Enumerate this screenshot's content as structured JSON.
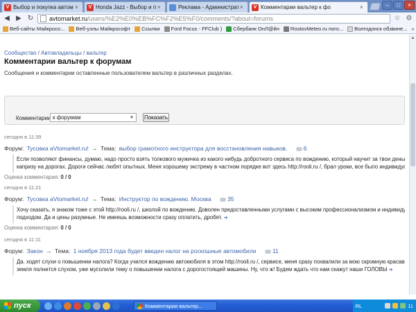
{
  "browser": {
    "tabs": [
      {
        "title": "Выбор и покупка автомобил",
        "favicon": "V",
        "favicon_color": "#d9342b",
        "active": false
      },
      {
        "title": "Honda Jazz - Выбор и покуп",
        "favicon": "V",
        "favicon_color": "#d9342b",
        "active": false
      },
      {
        "title": "Реклама - Административ",
        "favicon": "",
        "favicon_color": "#5b8ed8",
        "active": false
      },
      {
        "title": "Комментарии вальтер к фо",
        "favicon": "V",
        "favicon_color": "#d9342b",
        "active": true
      }
    ],
    "url_host": "avtomarket.ru",
    "url_path": "/users/%E2%E0%EB%FC%F2%E5%F0/comments/?about=forums",
    "bookmarks": [
      {
        "label": "Веб-сайты Майкросо...",
        "color": "#e8a33a"
      },
      {
        "label": "Веб-узлы Майкрософт",
        "color": "#e8a33a"
      },
      {
        "label": "Ссылки",
        "color": "#e8a33a"
      },
      {
        "label": "Ford Focus - FFClub )",
        "color": "#8c8c8c"
      },
      {
        "label": "Сбербанк ОнЛ@йн",
        "color": "#2e9b3f"
      },
      {
        "label": "RostovMeteo.ru пого...",
        "color": "#7a7a7a"
      },
      {
        "label": "Волгодонск обзвине...",
        "color": "#d6d6d6"
      }
    ],
    "bookmarks_more": "»"
  },
  "page": {
    "breadcrumbs": [
      "Сообщество",
      "Автовладельцы",
      "вальтер"
    ],
    "crumb_sep": " / ",
    "title": "Комментарии вальтер к форумам",
    "description": "Сообщения и комментарии оставленные пользователем вальтер в различных разделах.",
    "filter": {
      "label": "Комментарии:",
      "selected": "к форумам",
      "button": "Показать"
    },
    "forum_label": "Форум:",
    "topic_label": "Тема:",
    "arrow": "→",
    "rating_label": "Оценка комментария:",
    "comments": [
      {
        "time": "сегодня в 11:39",
        "forum": "Тусовка aVtomarket.ru!",
        "topic": "выбор грамотного инструктора для восстановления навыков.",
        "count": "6",
        "lines": [
          "Если позволяют финансы, думаю, надо просто взять толкового мужичка из какого нибудь добротного сервиса  по вождению, который научит за твои деньки любому",
          "капризу на дорогах.  Дороги сейчас любят опытных.  Меня хорошему экстрему в частном порядке вот здесь  http://rooli.ru /,  брал уроки,  все было индивидуально."
        ],
        "rating": "0 / 0"
      },
      {
        "time": "сегодня в 11:21",
        "forum": "Тусовка aVtomarket.ru!",
        "topic": "Инструктор по вождению. Москва",
        "count": "35",
        "lines": [
          "Хочу сказать, я знаком тоже с этой  http://rooli.ru /,  школой по вождению. Доволен предоставленными услугами  с высоким профессионализмом и индивидуальным",
          "подходом. Да и цены разумные. Не имеешь возможности сразу оплатить, дробят."
        ],
        "rating": "0 / 0"
      },
      {
        "time": "сегодня в 11:11",
        "forum": "Закон",
        "topic": "1 ноября 2013 года будет введен налог на роскошные автомобили",
        "count": "11",
        "lines": [
          "Да.  ходят слухи о повышении налога? Когда учился вождению автомобиля в этом http://rooli.ru /, сервисе, меня сразу похвалили за мою скромную красавицу, так как",
          "земля полнится слухом, уже мусолили тему о повышении налога с дорогостоящей машины. Ну, что ж! Будем ждать что нам скажут наши ГОЛОВЫ"
        ],
        "rating": ""
      }
    ]
  },
  "taskbar": {
    "start_label": "пуск",
    "task": "Комментарии вальтер...",
    "lang": "RL",
    "clock": "11"
  }
}
